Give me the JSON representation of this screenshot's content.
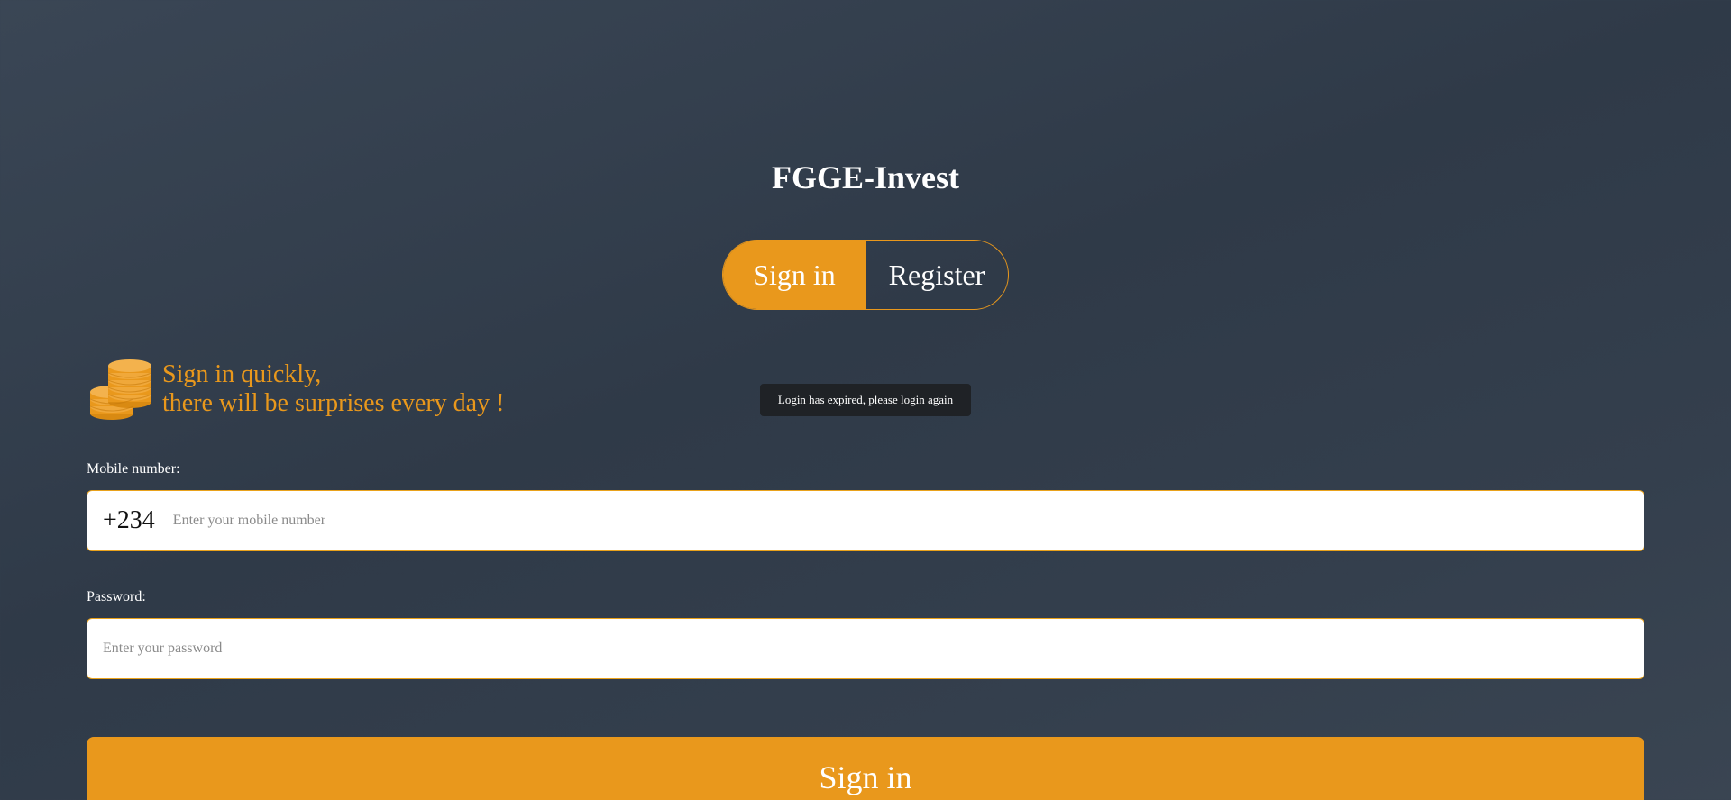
{
  "app": {
    "title": "FGGE-Invest"
  },
  "tabs": [
    {
      "label": "Sign in",
      "active": true
    },
    {
      "label": "Register",
      "active": false
    }
  ],
  "promo": {
    "icon": "coins-icon",
    "line1": "Sign in quickly,",
    "line2": "there will be surprises every day !"
  },
  "toast": {
    "message": "Login has expired, please login again"
  },
  "form": {
    "mobile": {
      "label": "Mobile number:",
      "country_code": "+234",
      "placeholder": "Enter your mobile number",
      "value": ""
    },
    "password": {
      "label": "Password:",
      "placeholder": "Enter your password",
      "value": ""
    },
    "submit_label": "Sign in"
  },
  "colors": {
    "accent": "#e9981c",
    "background": "#343f4d",
    "toast_bg": "#1f2226"
  }
}
